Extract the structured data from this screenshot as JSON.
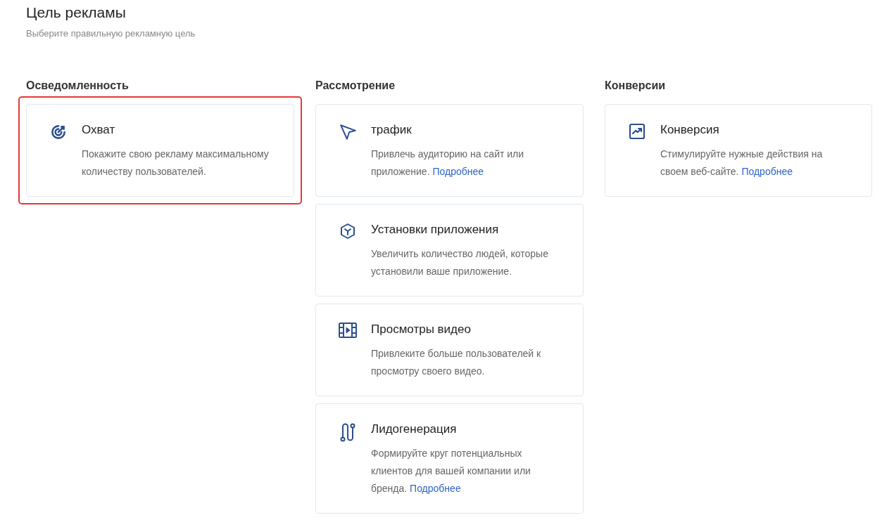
{
  "header": {
    "title": "Цель рекламы",
    "subtitle": "Выберите правильную рекламную цель"
  },
  "columns": [
    {
      "heading": "Осведомленность",
      "cards": [
        {
          "kind": "target",
          "title": "Охват",
          "description": "Покажите свою рекламу максимальному количеству пользователей.",
          "selected": true
        }
      ]
    },
    {
      "heading": "Рассмотрение",
      "cards": [
        {
          "kind": "cursor",
          "title": "трафик",
          "description": "Привлечь аудиторию на сайт или приложение.",
          "link": "Подробнее",
          "selected": false
        },
        {
          "kind": "cube",
          "title": "Установки приложения",
          "description": "Увеличить количество людей, которые установили ваше приложение.",
          "selected": false
        },
        {
          "kind": "film",
          "title": "Просмотры видео",
          "description": "Привлеките больше пользователей к просмотру своего видео.",
          "selected": false
        },
        {
          "kind": "route",
          "title": "Лидогенерация",
          "description": "Формируйте круг потенциальных клиентов для вашей компании или бренда.",
          "link": "Подробнее",
          "selected": false
        }
      ]
    },
    {
      "heading": "Конверсии",
      "cards": [
        {
          "kind": "chart",
          "title": "Конверсия",
          "description": "Стимулируйте нужные действия на своем веб-сайте.",
          "link": "Подробнее",
          "selected": false
        }
      ]
    }
  ]
}
